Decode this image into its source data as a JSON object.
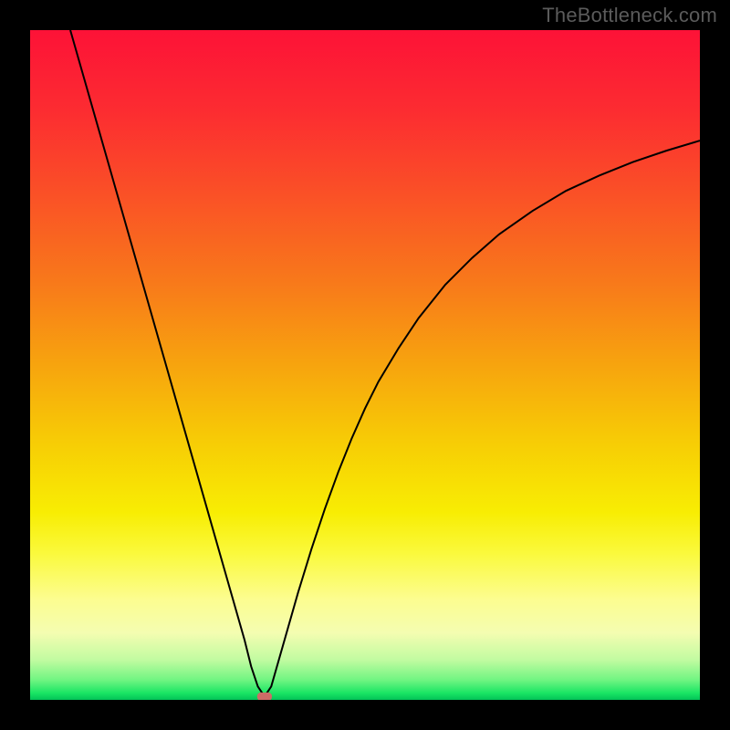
{
  "watermark": "TheBottleneck.com",
  "chart_data": {
    "type": "line",
    "title": "",
    "xlabel": "",
    "ylabel": "",
    "xlim": [
      0,
      100
    ],
    "ylim": [
      0,
      100
    ],
    "axes_visible": false,
    "grid": false,
    "background": {
      "type": "vertical-gradient",
      "stops": [
        {
          "offset": 0.0,
          "color": "#fd1237"
        },
        {
          "offset": 0.12,
          "color": "#fc2c31"
        },
        {
          "offset": 0.25,
          "color": "#fa5226"
        },
        {
          "offset": 0.38,
          "color": "#f87a1a"
        },
        {
          "offset": 0.5,
          "color": "#f7a40e"
        },
        {
          "offset": 0.62,
          "color": "#f7ce05"
        },
        {
          "offset": 0.72,
          "color": "#f8ed03"
        },
        {
          "offset": 0.78,
          "color": "#faf93b"
        },
        {
          "offset": 0.85,
          "color": "#fcfd90"
        },
        {
          "offset": 0.9,
          "color": "#f4fdb1"
        },
        {
          "offset": 0.94,
          "color": "#c2fba1"
        },
        {
          "offset": 0.97,
          "color": "#71f582"
        },
        {
          "offset": 0.99,
          "color": "#19e564"
        },
        {
          "offset": 1.0,
          "color": "#02c357"
        }
      ]
    },
    "series": [
      {
        "name": "bottleneck-curve",
        "color": "#000000",
        "stroke_width": 2,
        "x": [
          6,
          8,
          10,
          12,
          14,
          16,
          18,
          20,
          22,
          24,
          26,
          28,
          30,
          32,
          33,
          34,
          35,
          36,
          38,
          40,
          42,
          44,
          46,
          48,
          50,
          52,
          55,
          58,
          62,
          66,
          70,
          75,
          80,
          85,
          90,
          95,
          100
        ],
        "y": [
          100,
          93,
          86,
          79,
          72,
          65,
          58,
          51,
          44,
          37,
          30,
          23,
          16,
          9,
          5,
          2,
          0.5,
          2,
          9,
          16,
          22.5,
          28.5,
          34,
          39,
          43.5,
          47.5,
          52.5,
          57,
          62,
          66,
          69.5,
          73,
          76,
          78.3,
          80.3,
          82,
          83.5
        ]
      }
    ],
    "marker": {
      "name": "optimal-point",
      "x": 35,
      "y": 0.5,
      "shape": "rounded-rect",
      "color": "#cd6c67",
      "width": 2.2,
      "height": 1.2
    }
  }
}
